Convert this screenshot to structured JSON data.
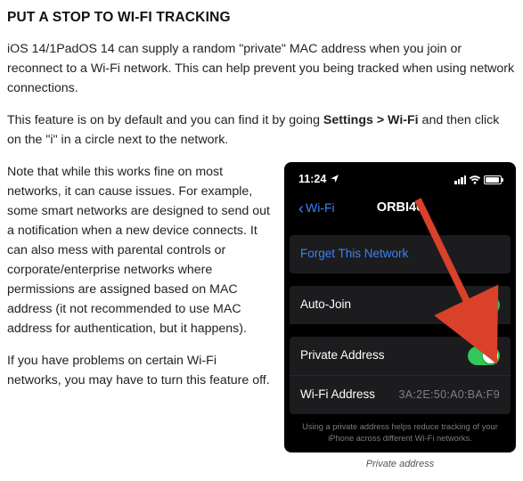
{
  "article": {
    "heading": "PUT A STOP TO WI-FI TRACKING",
    "para1_a": "iOS 14/1PadOS 14 can supply a random \"private\" MAC address when you join or reconnect to a Wi-Fi network. This can help prevent you being tracked when using network connections.",
    "para2_a": "This feature is on by default and you can find it by going ",
    "para2_b_strong": "Settings > Wi-Fi",
    "para2_c": " and then click on the \"i\" in a circle next to the network.",
    "para3": "Note that while this works fine on most networks, it can cause issues. For example, some smart networks are designed to send out a notification when a new device connects. It can also mess with parental controls or corporate/enterprise networks where permissions are assigned based on MAC address (it not recommended to use MAC address for authentication, but it happens).",
    "para4": "If you have problems on certain Wi-Fi networks, you may have to turn this feature off."
  },
  "phone": {
    "time": "11:24",
    "back_label": "Wi-Fi",
    "network_name": "ORBI46",
    "forget_label": "Forget This Network",
    "autojoin_label": "Auto-Join",
    "private_label": "Private Address",
    "wifiaddr_label": "Wi-Fi Address",
    "wifiaddr_value": "3A:2E:50:A0:BA:F9",
    "helper_text": "Using a private address helps reduce tracking of your iPhone across different Wi-Fi networks."
  },
  "caption": "Private address"
}
